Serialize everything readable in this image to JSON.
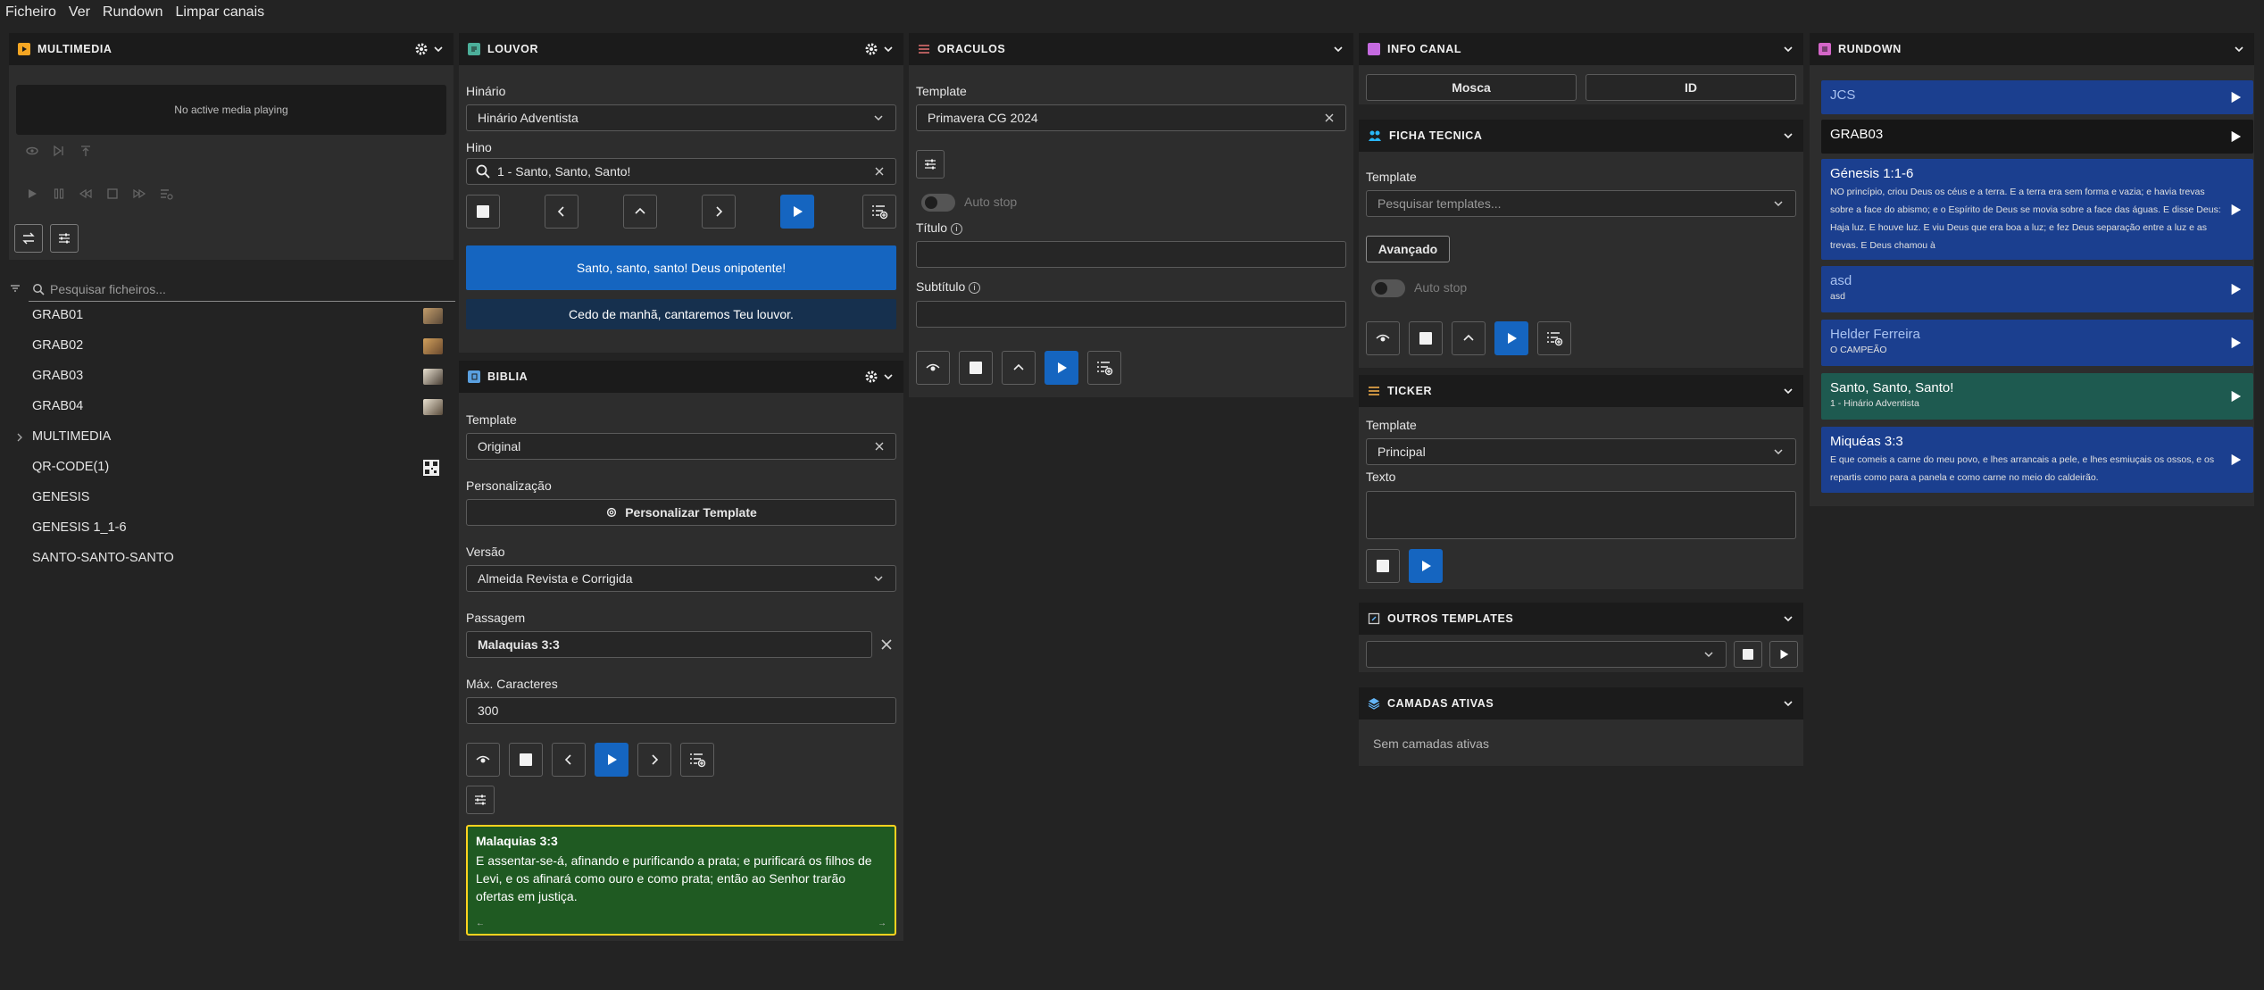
{
  "menu": [
    "Ficheiro",
    "Ver",
    "Rundown",
    "Limpar canais"
  ],
  "colors": {
    "accent_blue": "#1565c0",
    "dark_blue": "#1b3f8f",
    "teal": "#1e5a50",
    "green_box": "#1f5a22",
    "yellow_border": "#ffd21f",
    "gray_btn": "#5f5f5f"
  },
  "multimedia": {
    "title": "MULTIMEDIA",
    "no_media": "No active media playing",
    "search_placeholder": "Pesquisar ficheiros...",
    "files": [
      "GRAB01",
      "GRAB02",
      "GRAB03",
      "GRAB04",
      "MULTIMEDIA",
      "QR-CODE(1)",
      "GENESIS",
      "GENESIS 1_1-6",
      "SANTO-SANTO-SANTO"
    ]
  },
  "louvor": {
    "title": "LOUVOR",
    "hinario_label": "Hinário",
    "hinario_value": "Hinário Adventista",
    "hino_label": "Hino",
    "hino_value": "1 - Santo, Santo, Santo!",
    "verse_active": "Santo, santo, santo! Deus onipotente!",
    "verse_next": "Cedo de manhã, cantaremos Teu louvor."
  },
  "biblia": {
    "title": "BIBLIA",
    "template_label": "Template",
    "template_value": "Original",
    "personalizacao_label": "Personalização",
    "personalizar_button": "Personalizar Template",
    "versao_label": "Versão",
    "versao_value": "Almeida Revista e Corrigida",
    "passagem_label": "Passagem",
    "passagem_value": "Malaquias 3:3",
    "max_label": "Máx. Caracteres",
    "max_value": "300",
    "preview_title": "Malaquias 3:3",
    "preview_text": "E assentar-se-á, afinando e purificando a prata; e purificará os filhos de Levi, e os afinará como ouro e como prata; então ao Senhor trarão ofertas em justiça.",
    "prev_arrow": "←",
    "next_arrow": "→"
  },
  "oraculos": {
    "title": "ORACULOS",
    "template_label": "Template",
    "template_value": "Primavera CG 2024",
    "autostop_label": "Auto stop",
    "titulo_label": "Título",
    "subtitulo_label": "Subtítulo"
  },
  "info_canal": {
    "title": "INFO CANAL",
    "tab_mosca": "Mosca",
    "tab_id": "ID"
  },
  "ficha": {
    "title": "FICHA TECNICA",
    "template_label": "Template",
    "template_placeholder": "Pesquisar templates...",
    "avancado_button": "Avançado",
    "autostop_label": "Auto stop"
  },
  "ticker": {
    "title": "TICKER",
    "template_label": "Template",
    "template_value": "Principal",
    "texto_label": "Texto"
  },
  "outros": {
    "title": "OUTROS TEMPLATES"
  },
  "camadas": {
    "title": "CAMADAS ATIVAS",
    "empty": "Sem camadas ativas"
  },
  "rundown": {
    "title": "RUNDOWN",
    "items": [
      {
        "title": "JCS",
        "sub": "",
        "color": "#1b3f8f"
      },
      {
        "title": "GRAB03",
        "sub": "",
        "color": "#161616"
      },
      {
        "title": "Génesis 1:1-6",
        "sub": "NO princípio, criou Deus os céus e a terra. E a terra era sem forma e vazia; e havia trevas sobre a face do abismo; e o Espírito de Deus se movia sobre a face das águas. E disse Deus: Haja luz. E houve luz. E viu Deus que era boa a luz; e fez Deus separação entre a luz e as trevas. E Deus chamou à",
        "color": "#1b3f8f"
      },
      {
        "title": "asd",
        "sub": "asd",
        "color": "#1b3f8f"
      },
      {
        "title": "Helder Ferreira",
        "sub": "O CAMPEÃO",
        "color": "#1b3f8f"
      },
      {
        "title": "Santo, Santo, Santo!",
        "sub": "1 - Hinário Adventista",
        "color": "#1e5a50"
      },
      {
        "title": "Miquéas 3:3",
        "sub": "E que comeis a carne do meu povo, e lhes arrancais a pele, e lhes esmiuçais os ossos, e os repartis como para a panela e como carne no meio do caldeirão.",
        "color": "#1b3f8f"
      }
    ]
  }
}
